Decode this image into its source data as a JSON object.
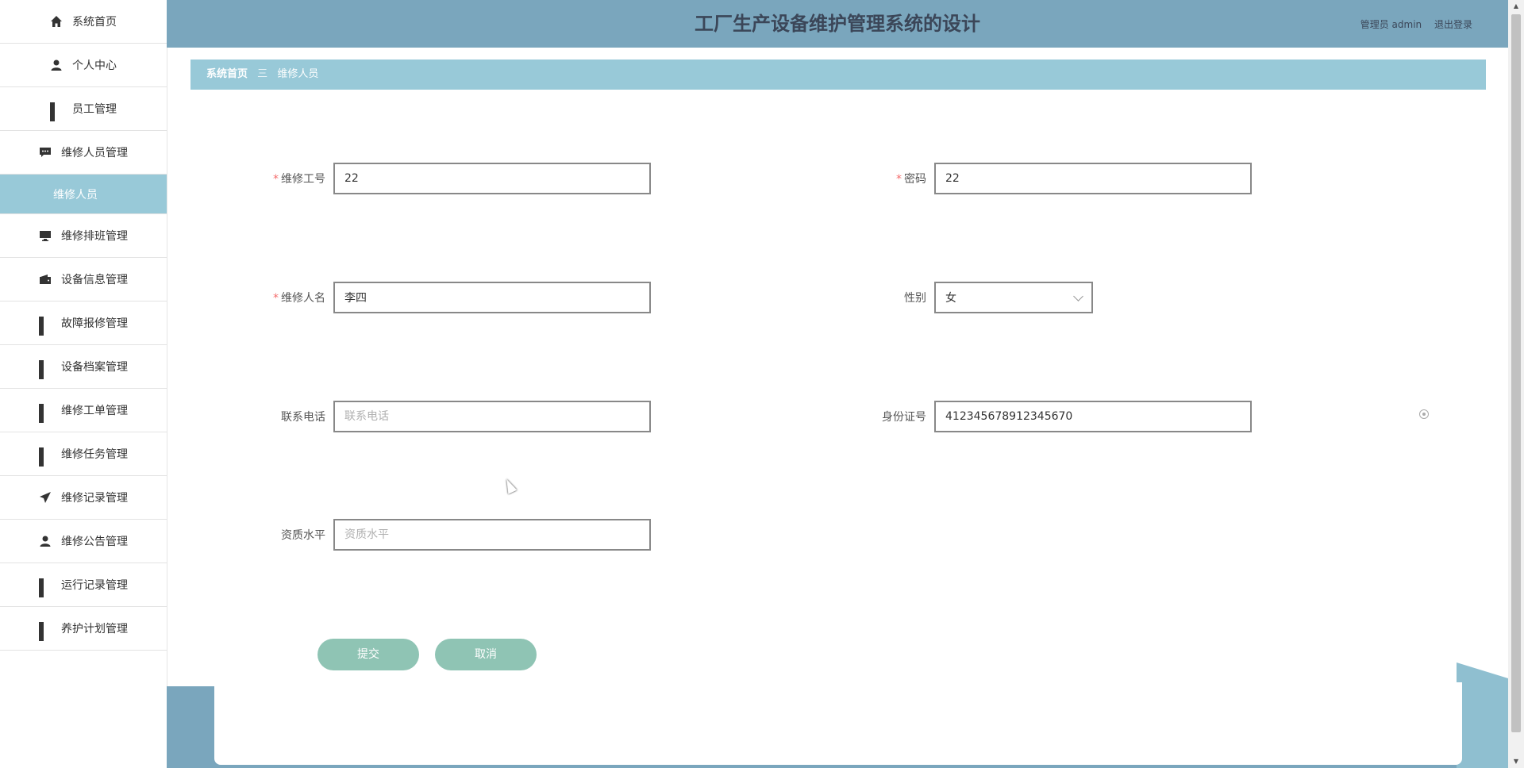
{
  "sidebar": {
    "items": [
      {
        "label": "系统首页",
        "icon": "home-icon"
      },
      {
        "label": "个人中心",
        "icon": "user-icon"
      },
      {
        "label": "员工管理",
        "icon": "grid-icon"
      },
      {
        "label": "维修人员管理",
        "icon": "chat-icon"
      },
      {
        "label": "维修人员",
        "icon": "",
        "sub": true
      },
      {
        "label": "维修排班管理",
        "icon": "monitor-icon"
      },
      {
        "label": "设备信息管理",
        "icon": "wallet-icon"
      },
      {
        "label": "故障报修管理",
        "icon": "grid-icon"
      },
      {
        "label": "设备档案管理",
        "icon": "grid-icon"
      },
      {
        "label": "维修工单管理",
        "icon": "grid-icon"
      },
      {
        "label": "维修任务管理",
        "icon": "grid-icon"
      },
      {
        "label": "维修记录管理",
        "icon": "send-icon"
      },
      {
        "label": "维修公告管理",
        "icon": "user-icon"
      },
      {
        "label": "运行记录管理",
        "icon": "grid-icon"
      },
      {
        "label": "养护计划管理",
        "icon": "grid-icon"
      }
    ]
  },
  "header": {
    "title": "工厂生产设备维护管理系统的设计",
    "user_role": "管理员 admin",
    "logout": "退出登录"
  },
  "breadcrumb": {
    "home": "系统首页",
    "separator": "三",
    "current": "维修人员"
  },
  "form": {
    "gonghao": {
      "label": "维修工号",
      "value": "22",
      "required": true
    },
    "mima": {
      "label": "密码",
      "value": "22",
      "required": true
    },
    "name": {
      "label": "维修人名",
      "value": "李四",
      "required": true
    },
    "gender": {
      "label": "性别",
      "value": "女"
    },
    "phone": {
      "label": "联系电话",
      "value": "",
      "placeholder": "联系电话"
    },
    "idcard": {
      "label": "身份证号",
      "value": "412345678912345670"
    },
    "qualification": {
      "label": "资质水平",
      "value": "",
      "placeholder": "资质水平"
    }
  },
  "buttons": {
    "submit": "提交",
    "cancel": "取消"
  },
  "colors": {
    "header_bg": "#7aa6bd",
    "breadcrumb_bg": "#98c9d8",
    "button_bg": "#8fc4b4",
    "required": "#f56c6c"
  }
}
